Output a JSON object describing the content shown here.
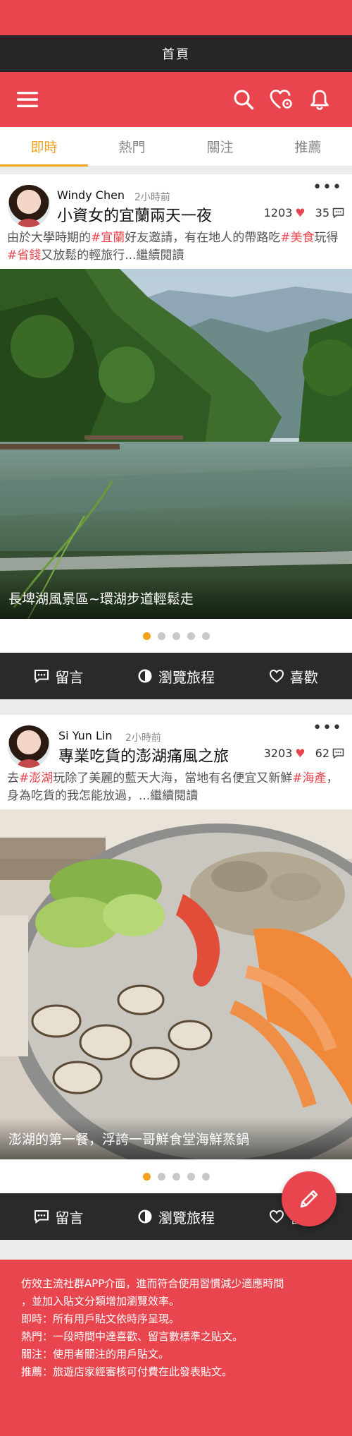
{
  "window": {
    "title": "首頁"
  },
  "app_bar": {
    "icons": [
      "menu-icon",
      "search-icon",
      "heart-settings-icon",
      "bell-icon"
    ]
  },
  "tabs": [
    {
      "label": "即時",
      "active": true
    },
    {
      "label": "熱門",
      "active": false
    },
    {
      "label": "關注",
      "active": false
    },
    {
      "label": "推薦",
      "active": false
    }
  ],
  "posts": [
    {
      "author": "Windy Chen",
      "time": "2小時前",
      "title": "小資女的宜蘭兩天一夜",
      "likes": "1203",
      "comments": "35",
      "excerpt": [
        {
          "text": "由於大學時期的",
          "tag": false
        },
        {
          "text": "#宜蘭",
          "tag": true
        },
        {
          "text": "好友邀請，有在地人的帶路吃",
          "tag": false
        },
        {
          "text": "#美食",
          "tag": true
        },
        {
          "text": "玩得",
          "tag": false
        },
        {
          "text": "#省錢",
          "tag": true
        },
        {
          "text": "又放鬆的輕旅行...繼續閱讀",
          "tag": false
        }
      ],
      "caption": "長埤湖風景區~環湖步道輕鬆走",
      "pager": {
        "count": 5,
        "active": 1
      }
    },
    {
      "author": "Si Yun Lin",
      "time": "2小時前",
      "title": "專業吃貨的澎湖痛風之旅",
      "likes": "3203",
      "comments": "62",
      "excerpt": [
        {
          "text": "去",
          "tag": false
        },
        {
          "text": "#澎湖",
          "tag": true
        },
        {
          "text": "玩除了美麗的藍天大海，當地有名便宜又新鮮",
          "tag": false
        },
        {
          "text": "#海產",
          "tag": true
        },
        {
          "text": "，身為吃貨的我怎能放過，...繼續閱讀",
          "tag": false
        }
      ],
      "caption": "澎湖的第一餐，浮誇一哥鮮食堂海鮮蒸鍋",
      "pager": {
        "count": 5,
        "active": 1
      }
    }
  ],
  "actions": {
    "comment": "留言",
    "browse": "瀏覽旅程",
    "like": "喜歡"
  },
  "footer": {
    "lines": [
      "仿效主流社群APP介面，進而符合使用習慣減少適應時間",
      "，並加入貼文分類增加瀏覽效率。",
      "即時：所有用戶貼文依時序呈現。",
      "熱門：一段時間中達喜歡、留言數標準之貼文。",
      "關注：使用者關注的用戶貼文。",
      "推薦：旅遊店家經審核可付費在此發表貼文。"
    ]
  },
  "colors": {
    "brand": "#e8454e",
    "accent": "#f2a21c",
    "dark": "#262626"
  }
}
